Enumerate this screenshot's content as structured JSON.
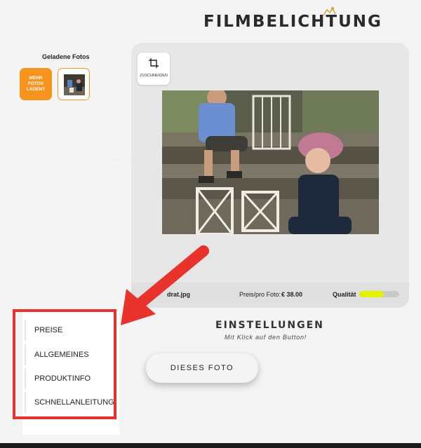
{
  "header": {
    "brand": "FILMBELICHTUNG"
  },
  "gallery": {
    "title": "Geladene Fotos",
    "more_button_line1": "MEHR",
    "more_button_line2": "FOTOS",
    "more_button_line3": "LADEN?"
  },
  "editor": {
    "crop_label": "ZUSCHNEIDEN",
    "filename": "drat.jpg",
    "price_label": "Preis/pro Foto:",
    "price_value": "€ 38.00",
    "quality_label": "Qualität",
    "quality_level": 0.62
  },
  "settings": {
    "title": "EINSTELLUNGEN",
    "subtitle": "Mit Klick auf den Button!",
    "button_label": "DIESES FOTO"
  },
  "menu": {
    "items": [
      {
        "label": "PREISE"
      },
      {
        "label": "ALLGEMEINES"
      },
      {
        "label": "PRODUKTINFO"
      },
      {
        "label": "SCHNELLANLEITUNG"
      }
    ]
  },
  "colors": {
    "accent": "#f7941d",
    "highlight": "#e8332c",
    "quality_fill": "#e6f100",
    "background": "#f4f4f4"
  },
  "icons": {
    "crop": "crop-icon",
    "brand_logo": "film-camera-logo-icon",
    "arrow": "red-arrow-annotation"
  }
}
